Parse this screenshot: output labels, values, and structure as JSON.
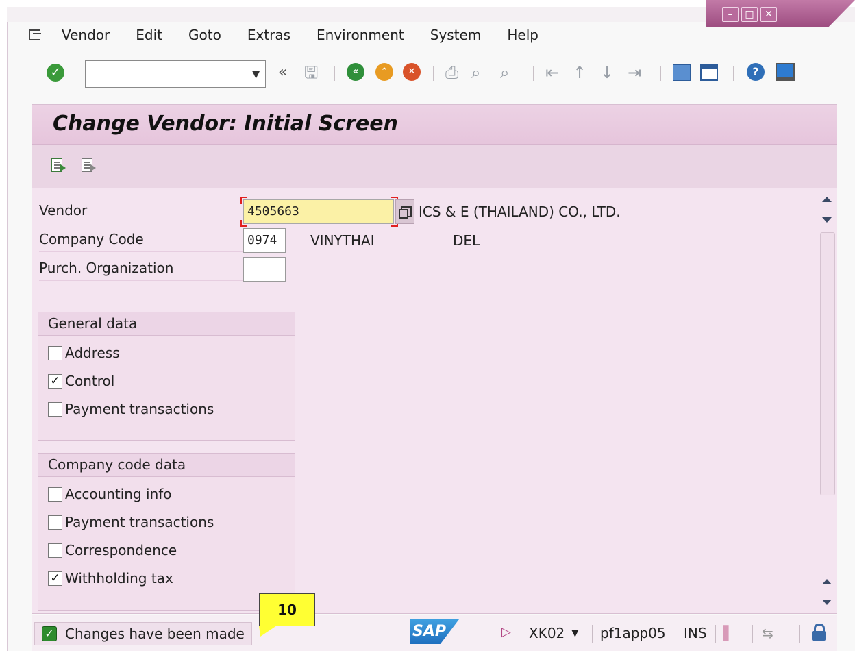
{
  "menu": {
    "items": [
      "Vendor",
      "Edit",
      "Goto",
      "Extras",
      "Environment",
      "System",
      "Help"
    ]
  },
  "window_controls": {
    "minimize": "–",
    "maximize": "□",
    "close": "✕"
  },
  "toolbar": {
    "command_field_value": "",
    "back_glyph": "«"
  },
  "screen": {
    "title": "Change Vendor: Initial Screen"
  },
  "fields": {
    "vendor": {
      "label": "Vendor",
      "value": "4505663",
      "description": "ICS & E (THAILAND) CO., LTD."
    },
    "company_code": {
      "label": "Company Code",
      "value": "0974",
      "description": "VINYTHAI",
      "description2": "DEL"
    },
    "purch_org": {
      "label": "Purch. Organization",
      "value": ""
    }
  },
  "general_data": {
    "title": "General data",
    "items": [
      {
        "label": "Address",
        "checked": false
      },
      {
        "label": "Control",
        "checked": true
      },
      {
        "label": "Payment transactions",
        "checked": false
      }
    ]
  },
  "company_code_data": {
    "title": "Company code data",
    "items": [
      {
        "label": "Accounting info",
        "checked": false
      },
      {
        "label": "Payment transactions",
        "checked": false
      },
      {
        "label": "Correspondence",
        "checked": false
      },
      {
        "label": "Withholding tax",
        "checked": true
      }
    ]
  },
  "status": {
    "message": "Changes have been made",
    "callout_number": "10",
    "logo": "SAP",
    "transaction": "XK02",
    "server": "pf1app05",
    "mode": "INS"
  },
  "colors": {
    "accent": "#b86a9c",
    "panel_bg": "#f4e4f0",
    "required_field": "#fbf1a6",
    "callout": "#ffff33"
  }
}
